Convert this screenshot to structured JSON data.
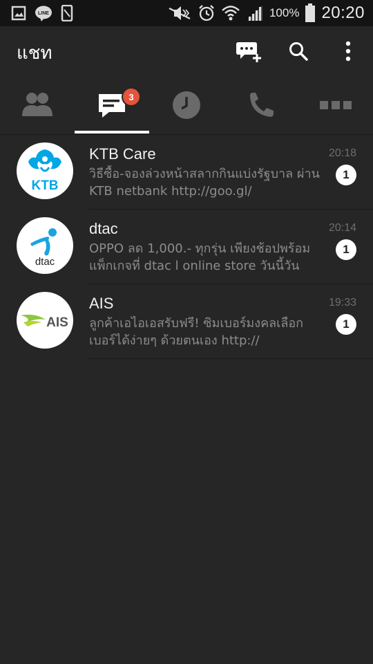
{
  "status_bar": {
    "left_icons": [
      "gallery-icon",
      "line-app-icon",
      "device-icon"
    ],
    "right_icons": [
      "mute-icon",
      "alarm-icon",
      "wifi-icon",
      "signal-icon",
      "battery-icon"
    ],
    "battery": "100%",
    "time": "20:20"
  },
  "header": {
    "title": "แชท",
    "actions": [
      "new-chat-icon",
      "search-icon",
      "more-vert-icon"
    ]
  },
  "tabs": {
    "items": [
      {
        "name": "friends",
        "icon": "friends-icon"
      },
      {
        "name": "chats",
        "icon": "chat-icon",
        "badge": "3",
        "active": true
      },
      {
        "name": "timeline",
        "icon": "clock-icon"
      },
      {
        "name": "calls",
        "icon": "phone-icon"
      },
      {
        "name": "more",
        "icon": "more-horiz-icon"
      }
    ]
  },
  "chats": [
    {
      "name": "KTB Care",
      "preview": "วิธีซื้อ-จองล่วงหน้าสลากกินแบ่งรัฐบาล ผ่าน KTB netbank http://goo.gl/",
      "time": "20:18",
      "unread": "1",
      "avatar_text": "KTB",
      "avatar_color": "#00a6e6"
    },
    {
      "name": "dtac",
      "preview": "OPPO ลด 1,000.- ทุกรุ่น เพียงช้อปพร้อมแพ็กเกจที่ dtac l online store วันนี้วัน",
      "time": "20:14",
      "unread": "1",
      "avatar_text": "dtac",
      "avatar_color": "#1aa3df"
    },
    {
      "name": "AIS",
      "preview": "ลูกค้าเอไอเอสรับฟรี! ซิมเบอร์มงคลเลือกเบอร์ได้ง่ายๆ ด้วยตนเอง http://",
      "time": "19:33",
      "unread": "1",
      "avatar_text": "AIS",
      "avatar_color": "#8dc63f"
    }
  ],
  "colors": {
    "background": "#262626",
    "status_bar": "#141414",
    "badge": "#e5533d",
    "tab_indicator": "#ffffff"
  }
}
